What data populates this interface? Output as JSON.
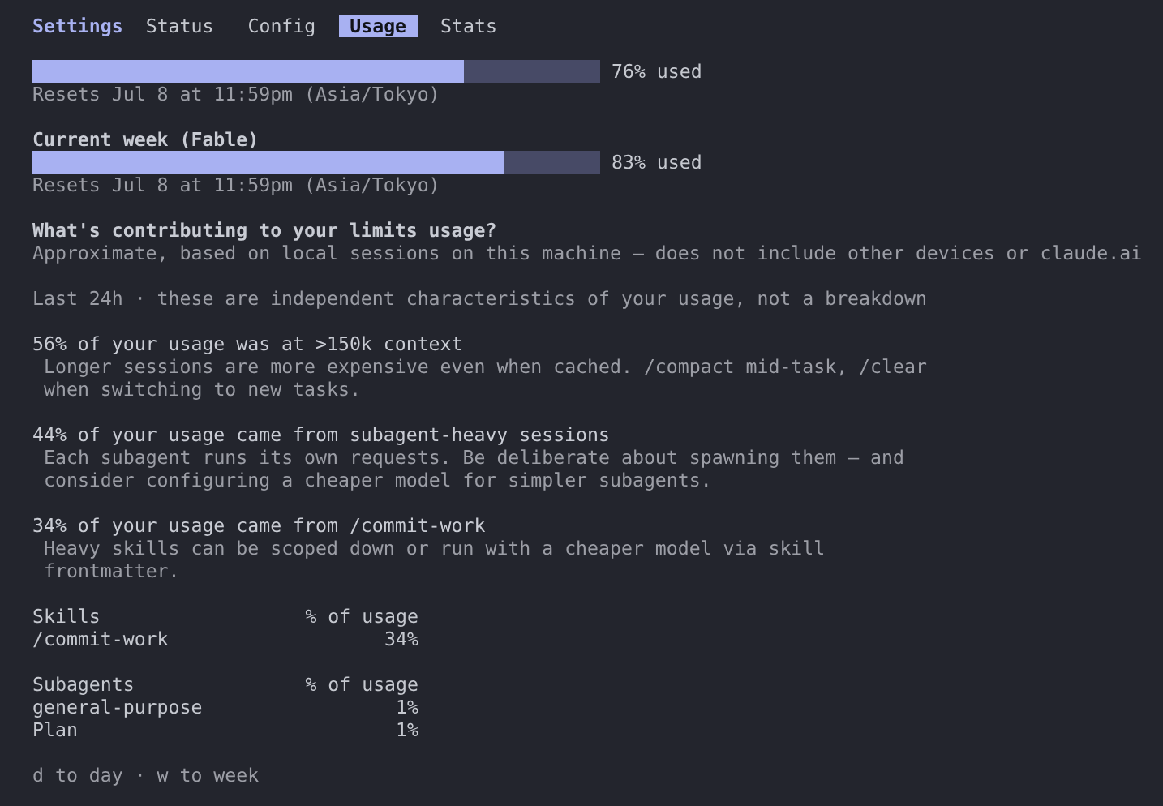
{
  "header": {
    "title": "Settings"
  },
  "tabs": [
    {
      "label": "Status",
      "selected": false
    },
    {
      "label": "Config",
      "selected": false
    },
    {
      "label": "Usage",
      "selected": true
    },
    {
      "label": "Stats",
      "selected": false
    }
  ],
  "meters": [
    {
      "level": 0.76,
      "reading": "76% used",
      "resets": "Resets Jul 8 at 11:59pm (Asia/Tokyo)"
    },
    {
      "title": "Current week (Fable)",
      "level": 0.83,
      "reading": "83% used",
      "resets": "Resets Jul 8 at 11:59pm (Asia/Tokyo)"
    }
  ],
  "contributions": {
    "heading": "What's contributing to your limits usage?",
    "note": "Approximate, based on local sessions on this machine — does not include other devices or claude.ai",
    "period": "Last 24h · these are independent characteristics of your usage, not a breakdown",
    "insights": [
      {
        "title": "56% of your usage was at >150k context",
        "lines": [
          "Longer sessions are more expensive even when cached. /compact mid-task, /clear",
          "when switching to new tasks."
        ]
      },
      {
        "title": "44% of your usage came from subagent-heavy sessions",
        "lines": [
          "Each subagent runs its own requests. Be deliberate about spawning them — and",
          "consider configuring a cheaper model for simpler subagents."
        ]
      },
      {
        "title": "34% of your usage came from /commit-work",
        "lines": [
          "Heavy skills can be scoped down or run with a cheaper model via skill",
          "frontmatter."
        ]
      }
    ]
  },
  "tables": [
    {
      "columns": [
        "Skills",
        "% of usage"
      ],
      "rows": [
        [
          "/commit-work",
          "34%"
        ]
      ]
    },
    {
      "columns": [
        "Subagents",
        "% of usage"
      ],
      "rows": [
        [
          "general-purpose",
          "1%"
        ],
        [
          "Plan",
          "1%"
        ]
      ]
    }
  ],
  "footer": "d to day · w to week"
}
